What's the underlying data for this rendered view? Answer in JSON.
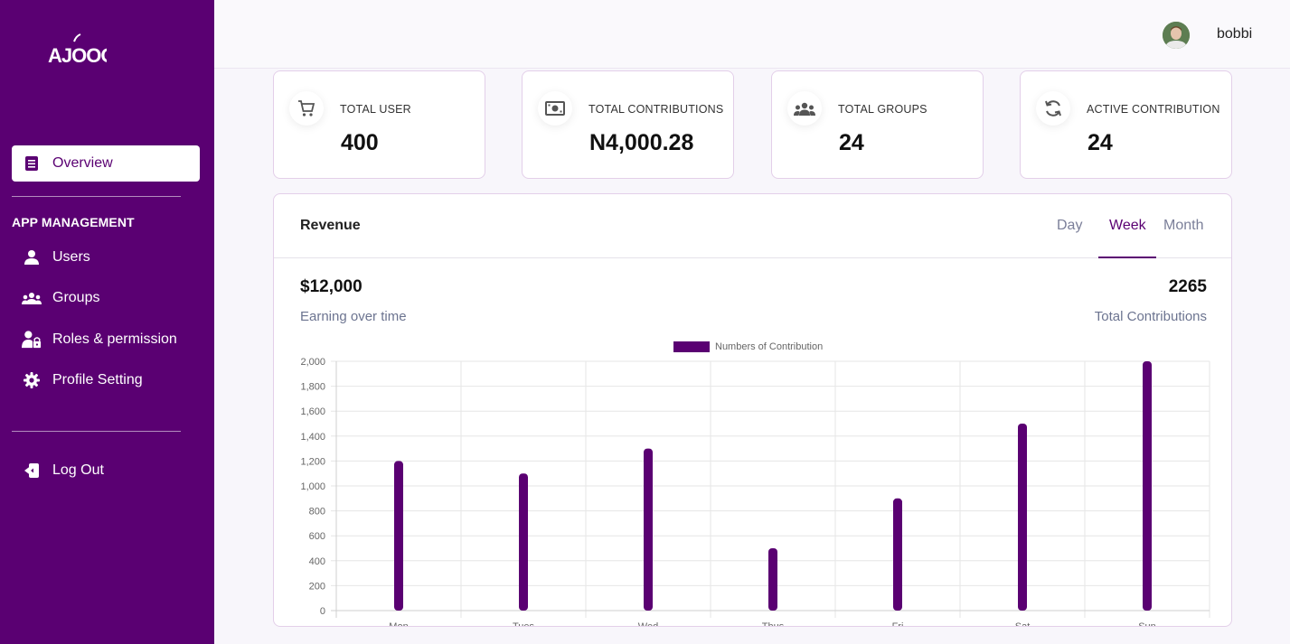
{
  "sidebar": {
    "logo_text": "AJOOO",
    "active_item": "Overview",
    "section_title": "APP MANAGEMENT",
    "items": [
      {
        "label": "Users",
        "icon": "person-icon"
      },
      {
        "label": "Groups",
        "icon": "groups-icon"
      },
      {
        "label": "Roles & permission",
        "icon": "user-lock-icon"
      },
      {
        "label": "Profile Setting",
        "icon": "gear-icon"
      }
    ],
    "logout_label": "Log Out",
    "background": "#5a0072"
  },
  "header": {
    "username": "bobbi"
  },
  "stats": [
    {
      "label": "TOTAL USER",
      "value": "400",
      "icon": "cart-icon"
    },
    {
      "label": "TOTAL CONTRIBUTIONS",
      "value": "N4,000.28",
      "icon": "money-icon"
    },
    {
      "label": "TOTAL GROUPS",
      "value": "24",
      "icon": "groups-icon"
    },
    {
      "label": "ACTIVE CONTRIBUTION",
      "value": "24",
      "icon": "refresh-icon"
    }
  ],
  "revenue": {
    "title": "Revenue",
    "tabs": [
      "Day",
      "Week",
      "Month"
    ],
    "active_tab": "Week",
    "earning_value": "$12,000",
    "earning_label": "Earning over time",
    "total_value": "2265",
    "total_label": "Total Contributions"
  },
  "chart_data": {
    "type": "bar",
    "categories": [
      "Mon",
      "Tues",
      "Wed",
      "Thus",
      "Fri",
      "Sat",
      "Sun"
    ],
    "series": [
      {
        "name": "Numbers of Contribution",
        "values": [
          1200,
          1100,
          1300,
          500,
          900,
          1500,
          2000
        ],
        "color": "#5a0072"
      }
    ],
    "ylim": [
      0,
      2000
    ],
    "yticks": [
      "0",
      "200",
      "400",
      "600",
      "800",
      "1,000",
      "1,200",
      "1,400",
      "1,600",
      "1,800",
      "2,000"
    ],
    "grid": true,
    "legend_position": "top-center"
  }
}
